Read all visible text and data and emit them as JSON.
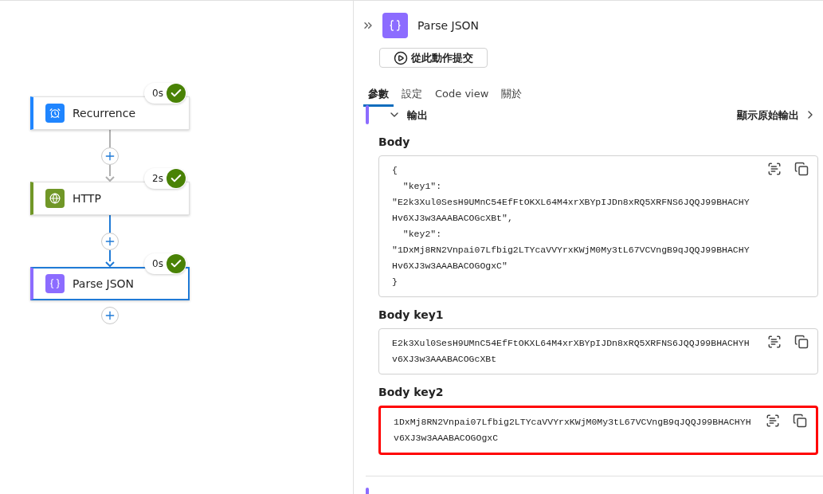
{
  "flow": {
    "nodes": [
      {
        "label": "Recurrence",
        "color": "#1f85ff",
        "kind": "schedule",
        "duration": "0s",
        "succeeded": true,
        "selected": false
      },
      {
        "label": "HTTP",
        "color": "#709727",
        "kind": "http",
        "duration": "2s",
        "succeeded": true,
        "selected": false
      },
      {
        "label": "Parse JSON",
        "color": "#8c6cff",
        "kind": "data",
        "duration": "0s",
        "succeeded": true,
        "selected": true
      }
    ]
  },
  "panel": {
    "title": "Parse JSON",
    "submit_button": "從此動作提交",
    "tabs": [
      {
        "label": "參數",
        "selected": true
      },
      {
        "label": "設定",
        "selected": false
      },
      {
        "label": "Code view",
        "selected": false
      },
      {
        "label": "關於",
        "selected": false
      }
    ],
    "section": {
      "title": "輸出",
      "expanded": true,
      "raw_link": "顯示原始輸出"
    },
    "fields": [
      {
        "label": "Body",
        "lines": [
          "{",
          "  \"key1\":",
          "\"E2k3Xul0SesH9UMnC54EfFtOKXL64M4xrXBYpIJDn8xRQ5XRFNS6JQQJ99BHACHY",
          "Hv6XJ3w3AAABACOGcXBt\",",
          "  \"key2\":",
          "\"1DxMj8RN2Vnpai07Lfbig2LTYcaVVYrxKWjM0My3tL67VCVngB9qJQQJ99BHACHY",
          "Hv6XJ3w3AAABACOGOgxC\"",
          "}"
        ],
        "highlighted": false
      },
      {
        "label": "Body key1",
        "lines": [
          "E2k3Xul0SesH9UMnC54EfFtOKXL64M4xrXBYpIJDn8xRQ5XRFNS6JQQJ99BHACHYH",
          "v6XJ3w3AAABACOGcXBt"
        ],
        "highlighted": false
      },
      {
        "label": "Body key2",
        "lines": [
          "1DxMj8RN2Vnpai07Lfbig2LTYcaVVYrxKWjM0My3tL67VCVngB9qJQQJ99BHACHYH",
          "v6XJ3w3AAABACOGOgxC"
        ],
        "highlighted": true
      }
    ]
  }
}
